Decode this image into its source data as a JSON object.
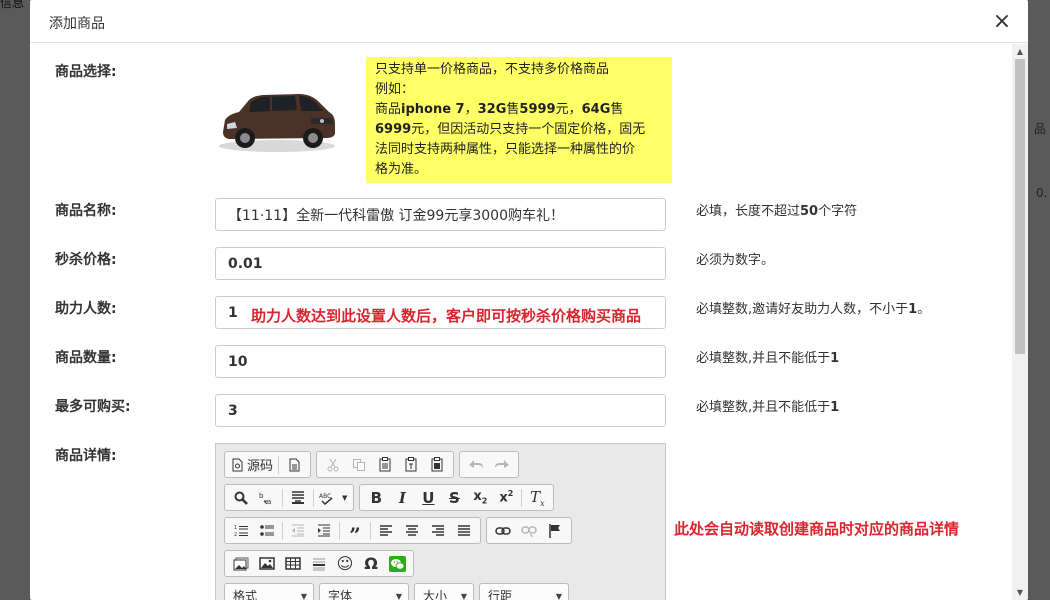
{
  "background": {
    "left_text": "信息",
    "right_text_1": "品",
    "right_text_2": "0."
  },
  "modal": {
    "title": "添加商品",
    "close_glyph": "×"
  },
  "form": {
    "product_select": {
      "label": "商品选择:",
      "note": {
        "line1": "只支持单一价格商品，不支持多价格商品",
        "line2": "例如：",
        "line3_a": "商品",
        "line3_b": "iphone 7",
        "line3_c": "，",
        "line3_d": "32G",
        "line3_e": "售",
        "line3_f": "5999",
        "line3_g": "元，",
        "line3_h": "64G",
        "line3_i": "售",
        "line4_a": "6999",
        "line4_b": "元，但因活动只支持一个固定价格，固无",
        "line5": "法同时支持两种属性，只能选择一种属性的价",
        "line6": "格为准。"
      }
    },
    "product_name": {
      "label": "商品名称:",
      "value": "【11·11】全新一代科雷傲 订金99元享3000购车礼！",
      "hint_a": "必填，长度不超过",
      "hint_b": "50",
      "hint_c": "个字符"
    },
    "seckill_price": {
      "label": "秒杀价格:",
      "value": "0.01",
      "hint": "必须为数字。"
    },
    "helpers": {
      "label": "助力人数:",
      "value": "1",
      "note": "助力人数达到此设置人数后，客户即可按秒杀价格购买商品",
      "hint_a": "必填整数,邀请好友助力人数，不小于",
      "hint_b": "1",
      "hint_c": "。"
    },
    "quantity": {
      "label": "商品数量:",
      "value": "10",
      "hint_a": "必填整数,并且不能低于",
      "hint_b": "1"
    },
    "max_buy": {
      "label": "最多可购买:",
      "value": "3",
      "hint_a": "必填整数,并且不能低于",
      "hint_b": "1"
    },
    "details": {
      "label": "商品详情:",
      "note": "此处会自动读取创建商品时对应的商品详情"
    }
  },
  "editor": {
    "source_label": "源码",
    "combos": [
      "格式",
      "字体",
      "大小",
      "行距"
    ]
  },
  "colors": {
    "note_bg": "#ffff66",
    "red_note": "#d9262e",
    "wechat": "#2bad13"
  }
}
